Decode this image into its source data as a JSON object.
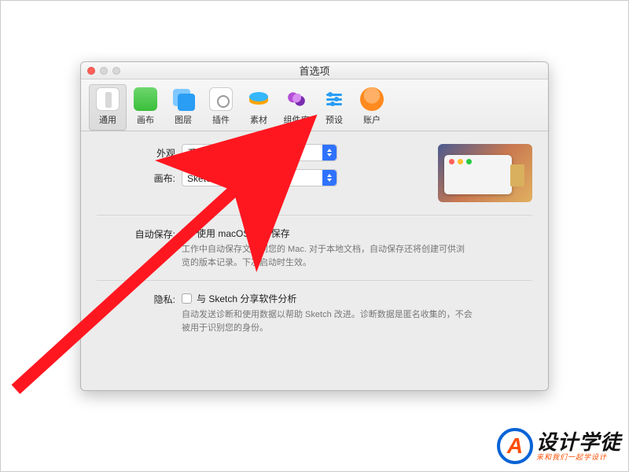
{
  "window": {
    "title": "首选项"
  },
  "toolbar": [
    {
      "id": "general",
      "label": "通用"
    },
    {
      "id": "canvas",
      "label": "画布"
    },
    {
      "id": "layers",
      "label": "图层"
    },
    {
      "id": "plugins",
      "label": "插件"
    },
    {
      "id": "data",
      "label": "素材"
    },
    {
      "id": "libraries",
      "label": "组件库"
    },
    {
      "id": "presets",
      "label": "预设"
    },
    {
      "id": "account",
      "label": "账户"
    }
  ],
  "form": {
    "appearance_label": "外观",
    "appearance_value": "系统默认",
    "canvas_label": "画布:",
    "canvas_value": "Sketch 默认"
  },
  "autosave": {
    "label": "自动保存:",
    "checkbox": "使用 macOS 自动保存",
    "desc": "工作中自动保存文档到您的 Mac. 对于本地文档，自动保存还将创建可供浏览的版本记录。下次启动时生效。"
  },
  "privacy": {
    "label": "隐私:",
    "checkbox": "与 Sketch 分享软件分析",
    "desc": "自动发送诊断和使用数据以帮助 Sketch 改进。诊断数据是匿名收集的，不会被用于识别您的身份。"
  },
  "watermark": {
    "badge": "A",
    "main": "设计学徒",
    "sub": "来和我们一起学设计"
  }
}
